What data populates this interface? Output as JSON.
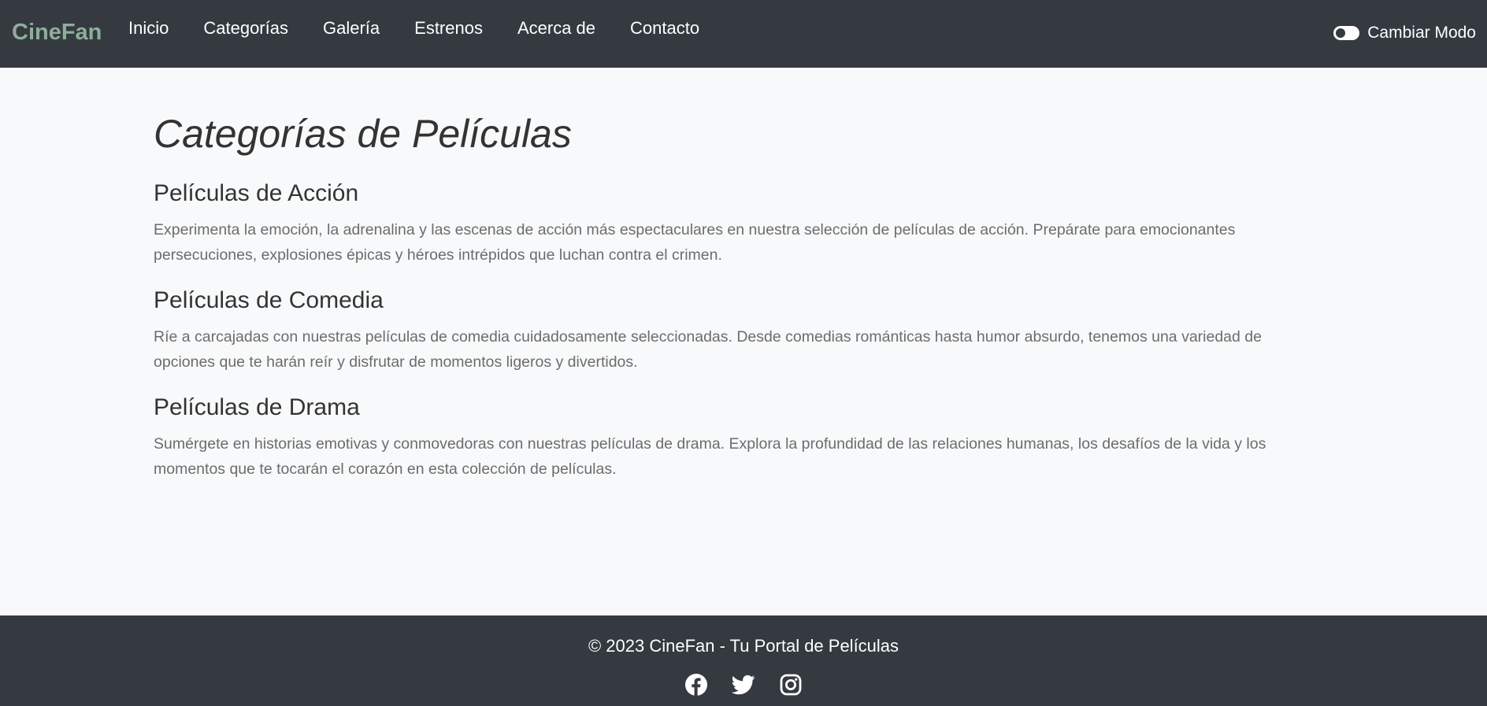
{
  "nav": {
    "brand": "CineFan",
    "links": [
      "Inicio",
      "Categorías",
      "Galería",
      "Estrenos",
      "Acerca de",
      "Contacto"
    ],
    "mode_toggle_label": "Cambiar Modo"
  },
  "main": {
    "title": "Categorías de Películas",
    "categories": [
      {
        "title": "Películas de Acción",
        "text": "Experimenta la emoción, la adrenalina y las escenas de acción más espectaculares en nuestra selección de películas de acción. Prepárate para emocionantes persecuciones, explosiones épicas y héroes intrépidos que luchan contra el crimen."
      },
      {
        "title": "Películas de Comedia",
        "text": "Ríe a carcajadas con nuestras películas de comedia cuidadosamente seleccionadas. Desde comedias románticas hasta humor absurdo, tenemos una variedad de opciones que te harán reír y disfrutar de momentos ligeros y divertidos."
      },
      {
        "title": "Películas de Drama",
        "text": "Sumérgete en historias emotivas y conmovedoras con nuestras películas de drama. Explora la profundidad de las relaciones humanas, los desafíos de la vida y los momentos que te tocarán el corazón en esta colección de películas."
      }
    ]
  },
  "footer": {
    "text": "© 2023 CineFan - Tu Portal de Películas",
    "social_icons": [
      "facebook-icon",
      "twitter-icon",
      "instagram-icon"
    ]
  },
  "colors": {
    "navbar_bg": "#343a40",
    "brand": "#8fae9a",
    "page_bg": "#f8f9fa",
    "footer_bg": "#343a40"
  }
}
